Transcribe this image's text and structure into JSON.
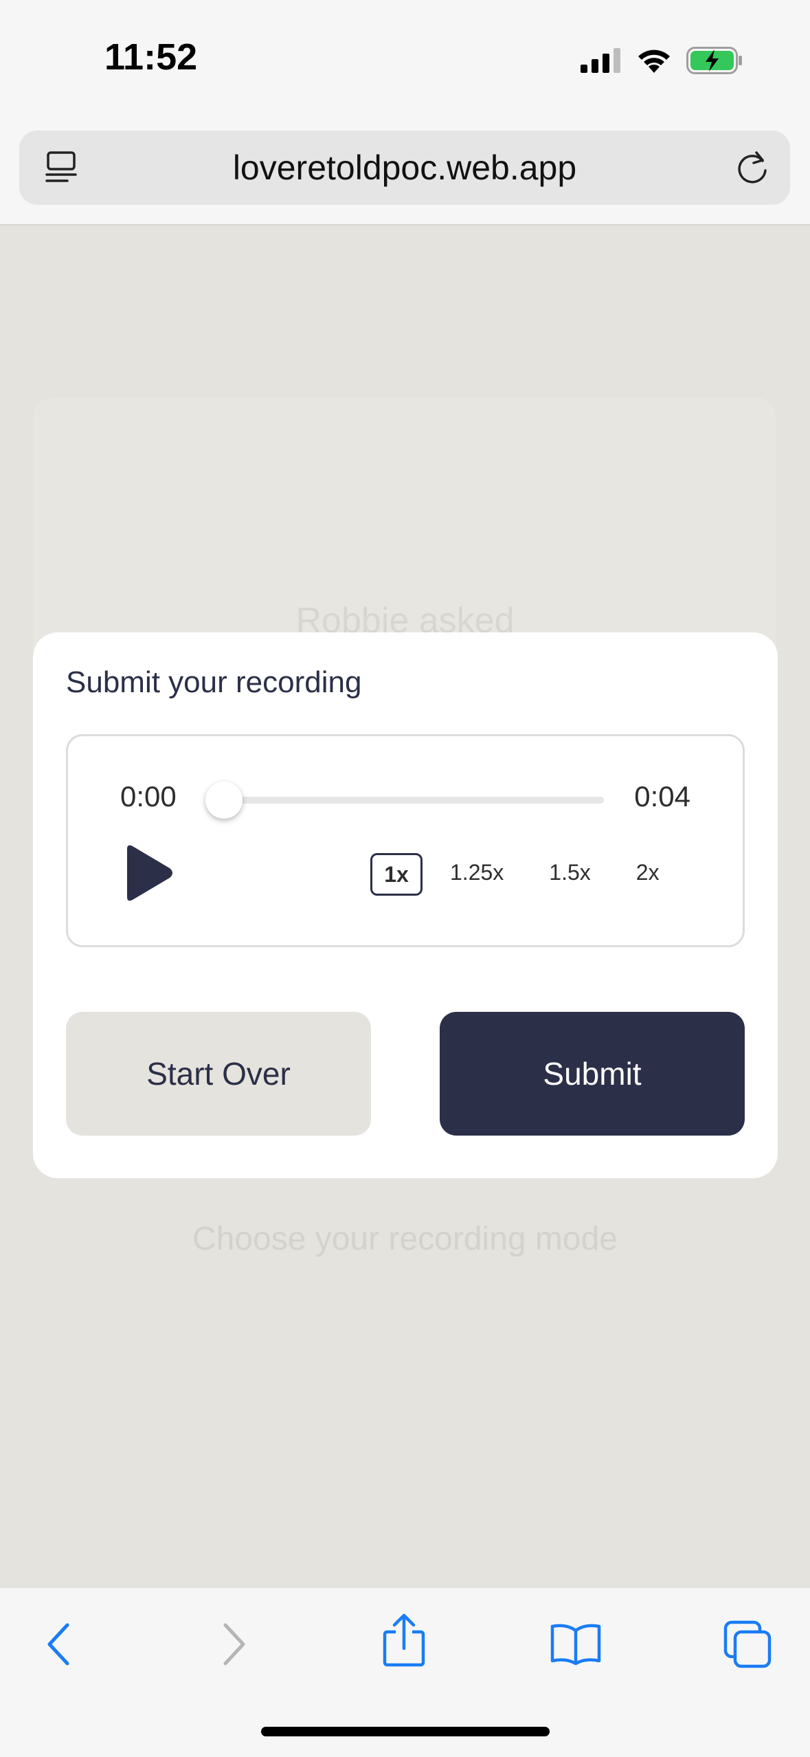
{
  "status_bar": {
    "time": "11:52"
  },
  "browser": {
    "url": "loveretoldpoc.web.app"
  },
  "background": {
    "heading": "Robbie asked",
    "choose_mode": "Choose your recording mode"
  },
  "modal": {
    "title": "Submit your recording",
    "player": {
      "current_time": "0:00",
      "duration": "0:04",
      "progress": 0,
      "speeds": [
        "1x",
        "1.25x",
        "1.5x",
        "2x"
      ],
      "selected_speed": "1x"
    },
    "start_over_label": "Start Over",
    "submit_label": "Submit"
  },
  "colors": {
    "accent": "#2b2f48",
    "page_background": "#e5e3dd",
    "ios_blue": "#1a7cf5"
  }
}
